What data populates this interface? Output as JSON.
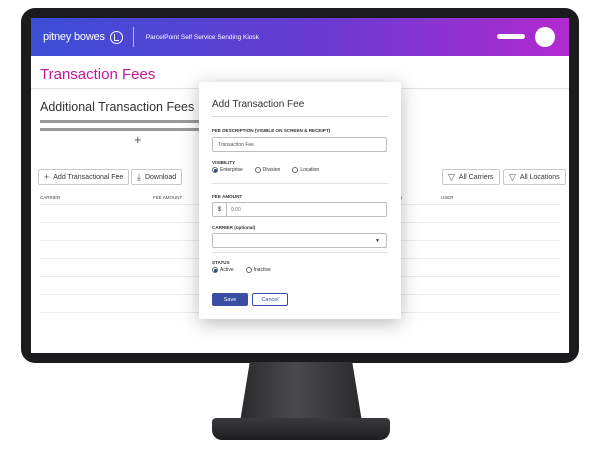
{
  "header": {
    "brand": "pitney bowes",
    "kiosk_title": "ParcelPoint Self Service Sending Kiosk"
  },
  "page": {
    "title": "Transaction Fees",
    "section_title": "Additional Transaction Fees"
  },
  "toolbar": {
    "add_label": "Add Transactional Fee",
    "download_label": "Download",
    "carriers_filter": "All Carriers",
    "locations_filter": "All Locations"
  },
  "table": {
    "columns": [
      "CARRIER",
      "FEE AMOUNT",
      "D",
      "USER"
    ]
  },
  "modal": {
    "title": "Add Transaction Fee",
    "description_label": "FEE DESCRIPTION (VISIBLE ON SCREEN & RECEIPT)",
    "description_value": "Transaction Fee",
    "visibility_label": "VISIBILITY",
    "visibility_options": [
      "Enterprise",
      "Division",
      "Location"
    ],
    "visibility_selected": "Enterprise",
    "fee_amount_label": "FEE AMOUNT",
    "currency_symbol": "$",
    "fee_amount_placeholder": "0.00",
    "carrier_label": "CARRIER (optional)",
    "status_label": "STATUS",
    "status_options": [
      "Active",
      "Inactive"
    ],
    "status_selected": "Active",
    "save_label": "Save",
    "cancel_label": "Cancel"
  },
  "colors": {
    "header_start": "#3c4ed6",
    "header_end": "#b12ad0",
    "title_magenta": "#c2189b",
    "primary_button": "#3a4ea3"
  }
}
